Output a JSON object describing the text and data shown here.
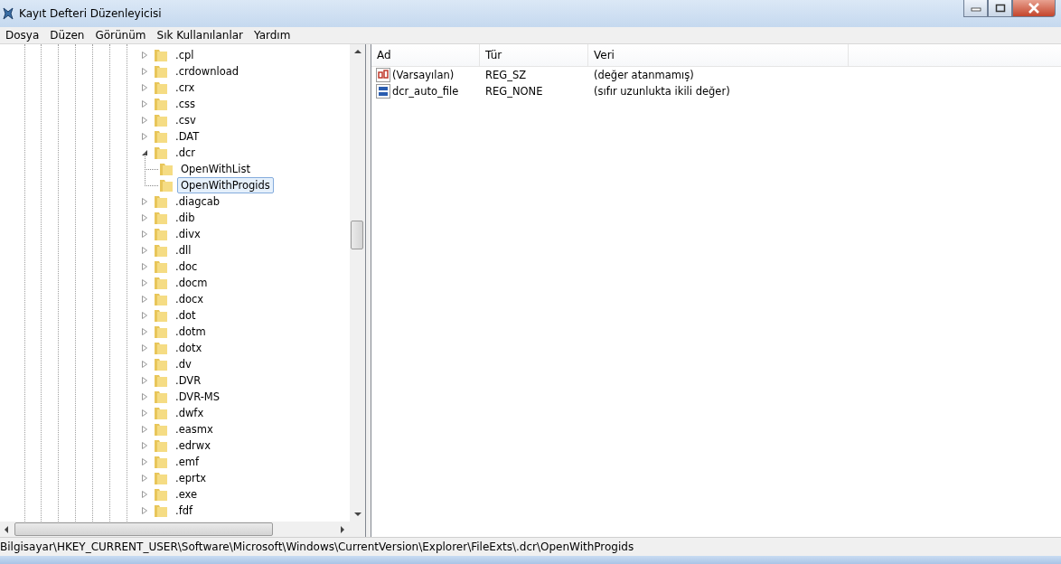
{
  "window": {
    "title": "Kayıt Defteri Düzenleyicisi"
  },
  "menu": [
    "Dosya",
    "Düzen",
    "Görünüm",
    "Sık Kullanılanlar",
    "Yardım"
  ],
  "tree": [
    {
      "label": ".cpl",
      "expanded": false,
      "selected": false
    },
    {
      "label": ".crdownload",
      "expanded": false,
      "selected": false
    },
    {
      "label": ".crx",
      "expanded": false,
      "selected": false
    },
    {
      "label": ".css",
      "expanded": false,
      "selected": false
    },
    {
      "label": ".csv",
      "expanded": false,
      "selected": false
    },
    {
      "label": ".DAT",
      "expanded": false,
      "selected": false
    },
    {
      "label": ".dcr",
      "expanded": true,
      "selected": false,
      "children": [
        {
          "label": "OpenWithList",
          "selected": false
        },
        {
          "label": "OpenWithProgids",
          "selected": true
        }
      ]
    },
    {
      "label": ".diagcab",
      "expanded": false,
      "selected": false
    },
    {
      "label": ".dib",
      "expanded": false,
      "selected": false
    },
    {
      "label": ".divx",
      "expanded": false,
      "selected": false
    },
    {
      "label": ".dll",
      "expanded": false,
      "selected": false
    },
    {
      "label": ".doc",
      "expanded": false,
      "selected": false
    },
    {
      "label": ".docm",
      "expanded": false,
      "selected": false
    },
    {
      "label": ".docx",
      "expanded": false,
      "selected": false
    },
    {
      "label": ".dot",
      "expanded": false,
      "selected": false
    },
    {
      "label": ".dotm",
      "expanded": false,
      "selected": false
    },
    {
      "label": ".dotx",
      "expanded": false,
      "selected": false
    },
    {
      "label": ".dv",
      "expanded": false,
      "selected": false
    },
    {
      "label": ".DVR",
      "expanded": false,
      "selected": false
    },
    {
      "label": ".DVR-MS",
      "expanded": false,
      "selected": false
    },
    {
      "label": ".dwfx",
      "expanded": false,
      "selected": false
    },
    {
      "label": ".easmx",
      "expanded": false,
      "selected": false
    },
    {
      "label": ".edrwx",
      "expanded": false,
      "selected": false
    },
    {
      "label": ".emf",
      "expanded": false,
      "selected": false
    },
    {
      "label": ".eprtx",
      "expanded": false,
      "selected": false
    },
    {
      "label": ".exe",
      "expanded": false,
      "selected": false
    },
    {
      "label": ".fdf",
      "expanded": false,
      "selected": false
    }
  ],
  "values": {
    "columns": [
      "Ad",
      "Tür",
      "Veri"
    ],
    "rows": [
      {
        "kind": "string",
        "name": "(Varsayılan)",
        "type": "REG_SZ",
        "data": "(değer atanmamış)"
      },
      {
        "kind": "binary",
        "name": "dcr_auto_file",
        "type": "REG_NONE",
        "data": "(sıfır uzunlukta ikili değer)"
      }
    ]
  },
  "status_bar": "Bilgisayar\\HKEY_CURRENT_USER\\Software\\Microsoft\\Windows\\CurrentVersion\\Explorer\\FileExts\\.dcr\\OpenWithProgids"
}
